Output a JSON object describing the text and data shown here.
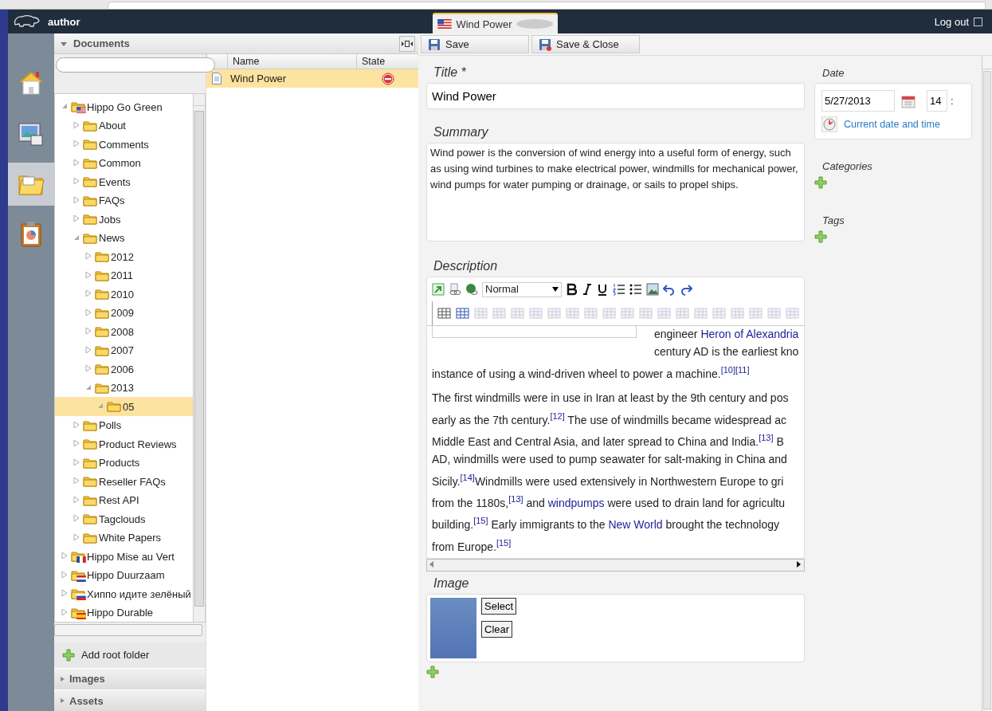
{
  "header": {
    "user": "author",
    "tab": {
      "title": "Wind Power",
      "kind": "english"
    },
    "logout": "Log out"
  },
  "nav": [
    {
      "kind": "home",
      "selected": false
    },
    {
      "kind": "gallery",
      "selected": false
    },
    {
      "kind": "folder",
      "selected": true
    },
    {
      "kind": "clipboard",
      "selected": false
    }
  ],
  "documents": {
    "title": "Documents",
    "tree": [
      {
        "label": "Hippo Go Green",
        "kind": "english",
        "expanded": true,
        "selected": false,
        "children": [
          {
            "label": "About",
            "expanded": false,
            "selected": false
          },
          {
            "label": "Comments",
            "expanded": false,
            "selected": false
          },
          {
            "label": "Common",
            "expanded": false,
            "selected": false
          },
          {
            "label": "Events",
            "expanded": false,
            "selected": false
          },
          {
            "label": "FAQs",
            "expanded": false,
            "selected": false
          },
          {
            "label": "Jobs",
            "expanded": false,
            "selected": false
          },
          {
            "label": "News",
            "expanded": true,
            "selected": false,
            "children": [
              {
                "label": "2012",
                "expanded": false,
                "selected": false
              },
              {
                "label": "2011",
                "expanded": false,
                "selected": false
              },
              {
                "label": "2010",
                "expanded": false,
                "selected": false
              },
              {
                "label": "2009",
                "expanded": false,
                "selected": false
              },
              {
                "label": "2008",
                "expanded": false,
                "selected": false
              },
              {
                "label": "2007",
                "expanded": false,
                "selected": false
              },
              {
                "label": "2006",
                "expanded": false,
                "selected": false
              },
              {
                "label": "2013",
                "expanded": true,
                "selected": false,
                "children": [
                  {
                    "label": "05",
                    "expanded": true,
                    "selected": true
                  }
                ]
              }
            ]
          },
          {
            "label": "Polls",
            "expanded": false,
            "selected": false
          },
          {
            "label": "Product Reviews",
            "expanded": false,
            "selected": false
          },
          {
            "label": "Products",
            "expanded": false,
            "selected": false
          },
          {
            "label": "Reseller FAQs",
            "expanded": false,
            "selected": false
          },
          {
            "label": "Rest API",
            "expanded": false,
            "selected": false
          },
          {
            "label": "Tagclouds",
            "expanded": false,
            "selected": false
          },
          {
            "label": "White Papers",
            "expanded": false,
            "selected": false
          }
        ]
      },
      {
        "label": "Hippo Mise au Vert",
        "kind": "french",
        "expanded": false,
        "selected": false
      },
      {
        "label": "Hippo Duurzaam",
        "kind": "dutch",
        "expanded": false,
        "selected": false
      },
      {
        "label": "Хиппо идите зелёный",
        "kind": "russian",
        "expanded": false,
        "selected": false
      },
      {
        "label": "Hippo Durable",
        "kind": "spanish",
        "expanded": false,
        "selected": false
      }
    ],
    "add_root": "Add root folder",
    "sections": [
      "Images",
      "Assets"
    ]
  },
  "list": {
    "columns": [
      "Name",
      "State"
    ],
    "rows": [
      {
        "name": "Wind Power",
        "published": false,
        "selected": true
      }
    ]
  },
  "editor": {
    "buttons": [
      {
        "label": "Save",
        "kind": "save"
      },
      {
        "label": "Save & Close",
        "kind": "save-close"
      }
    ],
    "title": {
      "label": "Title *",
      "value": "Wind Power"
    },
    "summary": {
      "label": "Summary",
      "value": "Wind power is the conversion of wind energy into a useful form of energy, such as using wind turbines to make electrical power, windmills for mechanical power, wind pumps for water pumping or drainage, or sails to propel ships."
    },
    "description": {
      "label": "Description",
      "format": "Normal",
      "paragraphs": [
        [
          [
            {
              "kind": "text",
              "text": "engineer "
            },
            {
              "kind": "link",
              "text": "Heron of Alexandria"
            }
          ],
          [
            {
              "kind": "text",
              "text": "century AD is the earliest kno"
            }
          ],
          [
            {
              "kind": "text",
              "text": "instance of using a wind-driven wheel to power a machine."
            },
            {
              "kind": "ref",
              "text": "[10]"
            },
            {
              "kind": "ref",
              "text": "[11]"
            }
          ]
        ],
        [
          [
            {
              "kind": "text",
              "text": "The first windmills were in use in Iran at least by the 9th century and pos"
            }
          ],
          [
            {
              "kind": "text",
              "text": "early as the 7th century."
            },
            {
              "kind": "ref",
              "text": "[12]"
            },
            {
              "kind": "text",
              "text": " The use of windmills became widespread ac"
            }
          ],
          [
            {
              "kind": "text",
              "text": "Middle East and Central Asia, and later spread to China and India."
            },
            {
              "kind": "ref",
              "text": "[13]"
            },
            {
              "kind": "text",
              "text": " B"
            }
          ],
          [
            {
              "kind": "text",
              "text": "AD, windmills were used to pump seawater for salt-making in China and"
            }
          ],
          [
            {
              "kind": "text",
              "text": "Sicily."
            },
            {
              "kind": "ref",
              "text": "[14]"
            },
            {
              "kind": "text",
              "text": "Windmills were used extensively in Northwestern Europe to gri"
            }
          ],
          [
            {
              "kind": "text",
              "text": "from the 1180s,"
            },
            {
              "kind": "ref",
              "text": "[13]"
            },
            {
              "kind": "text",
              "text": " and "
            },
            {
              "kind": "link",
              "text": "windpumps"
            },
            {
              "kind": "text",
              "text": " were used to drain land for agricultu"
            }
          ],
          [
            {
              "kind": "text",
              "text": "building."
            },
            {
              "kind": "ref",
              "text": "[15]"
            },
            {
              "kind": "text",
              "text": " Early immigrants to the "
            },
            {
              "kind": "link",
              "text": "New World"
            },
            {
              "kind": "text",
              "text": " brought the technology"
            }
          ],
          [
            {
              "kind": "text",
              "text": "from Europe."
            },
            {
              "kind": "ref",
              "text": "[15]"
            }
          ]
        ]
      ]
    },
    "image": {
      "label": "Image",
      "buttons": [
        "Select",
        "Clear"
      ]
    }
  },
  "side": {
    "date": {
      "label": "Date",
      "value": "5/27/2013",
      "hour": "14",
      "separator": ":",
      "now_link": "Current date and time"
    },
    "categories": "Categories",
    "tags": "Tags"
  }
}
